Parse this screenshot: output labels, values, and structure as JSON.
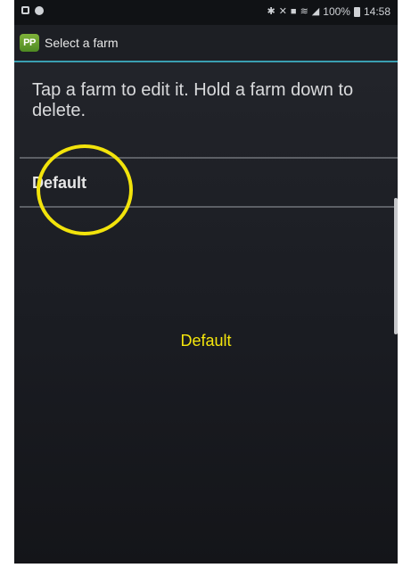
{
  "status_bar": {
    "battery": "100%",
    "time": "14:58",
    "left_icons": [
      "notification-icon",
      "chat-icon"
    ],
    "right_icons": [
      "bluetooth-icon",
      "mute-icon",
      "nfc-icon",
      "wifi-icon",
      "signal-icon",
      "battery-icon"
    ]
  },
  "title_bar": {
    "app_icon_text": "PP",
    "title": "Select a farm",
    "accent_color": "#3a9fb1"
  },
  "instructions": "Tap a farm to edit it. Hold a farm down to delete.",
  "farms": [
    {
      "name": "Default"
    }
  ],
  "annotation": {
    "label": "Default",
    "color": "#f5e60c"
  }
}
